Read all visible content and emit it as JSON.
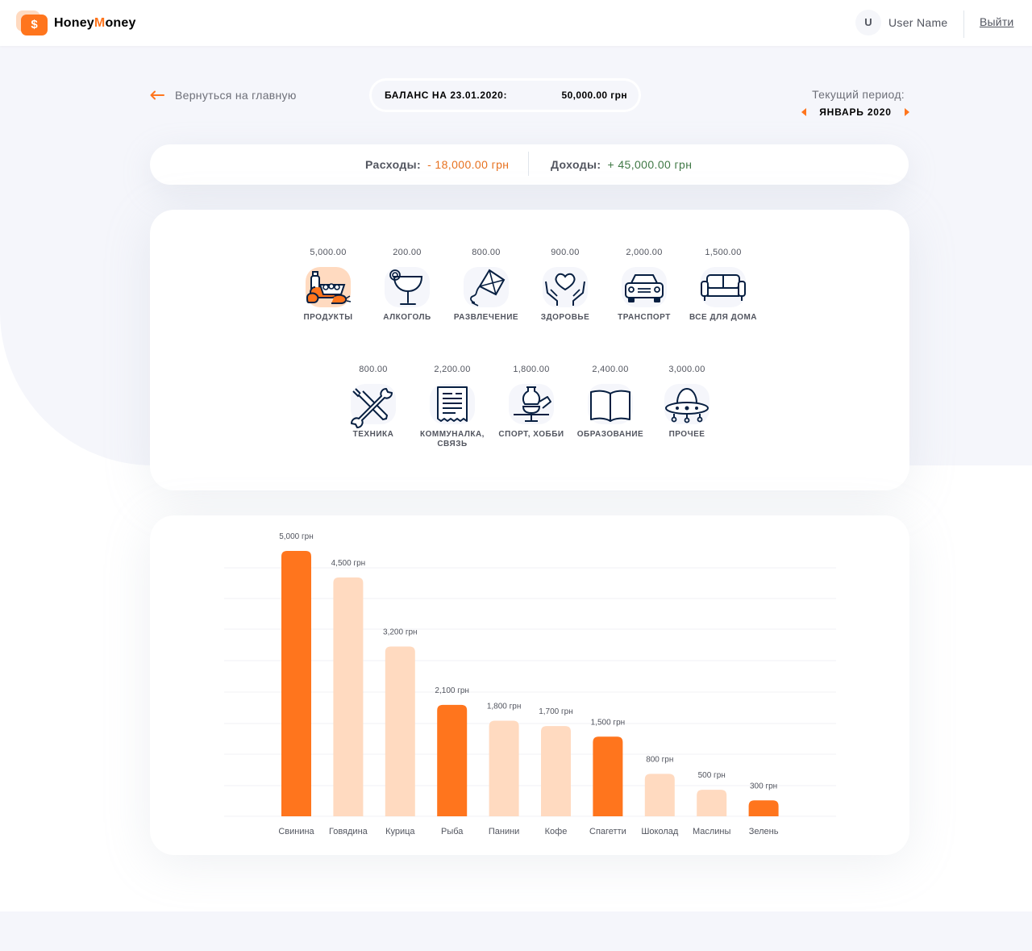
{
  "header": {
    "logo_part1": "Honey",
    "logo_part2": "M",
    "logo_part3": "oney",
    "logo_symbol": "$",
    "avatar_letter": "U",
    "user_name": "User Name",
    "logout_label": "Выйти"
  },
  "nav": {
    "back_label": "Вернуться на главную",
    "balance_label": "БАЛАНС НА 23.01.2020:",
    "balance_value": "50,000.00 грн",
    "period_label": "Текущий период:",
    "period_value": "ЯНВАРЬ 2020"
  },
  "summary": {
    "expenses_label": "Расходы:",
    "expenses_value": "- 18,000.00 грн",
    "income_label": "Доходы:",
    "income_value": "+ 45,000.00 грн"
  },
  "categories": [
    {
      "amount": "5,000.00",
      "label": "ПРОДУКТЫ",
      "icon": "groceries-icon",
      "active": true
    },
    {
      "amount": "200.00",
      "label": "АЛКОГОЛЬ",
      "icon": "cocktail-icon",
      "active": false
    },
    {
      "amount": "800.00",
      "label": "РАЗВЛЕЧЕНИЕ",
      "icon": "kite-icon",
      "active": false
    },
    {
      "amount": "900.00",
      "label": "ЗДОРОВЬЕ",
      "icon": "heart-hands-icon",
      "active": false
    },
    {
      "amount": "2,000.00",
      "label": "ТРАНСПОРТ",
      "icon": "car-icon",
      "active": false
    },
    {
      "amount": "1,500.00",
      "label": "ВСЕ ДЛЯ ДОМА",
      "icon": "sofa-icon",
      "active": false
    },
    {
      "amount": "800.00",
      "label": "ТЕХНИКА",
      "icon": "tools-icon",
      "active": false
    },
    {
      "amount": "2,200.00",
      "label": "КОММУНАЛКА, СВЯЗЬ",
      "icon": "receipt-icon",
      "active": false
    },
    {
      "amount": "1,800.00",
      "label": "СПОРТ, ХОББИ",
      "icon": "pottery-icon",
      "active": false
    },
    {
      "amount": "2,400.00",
      "label": "ОБРАЗОВАНИЕ",
      "icon": "book-icon",
      "active": false
    },
    {
      "amount": "3,000.00",
      "label": "ПРОЧЕЕ",
      "icon": "ufo-icon",
      "active": false
    }
  ],
  "colors": {
    "accent": "#ff751d",
    "accent_light": "#ffdac0",
    "expense": "#e7711f",
    "income": "#407946",
    "icon_stroke": "#071f41"
  },
  "chart_data": {
    "type": "bar",
    "categories": [
      "Свинина",
      "Говядина",
      "Курица",
      "Рыба",
      "Панини",
      "Кофе",
      "Спагетти",
      "Шоколад",
      "Маслины",
      "Зелень"
    ],
    "values": [
      5000,
      4500,
      3200,
      2100,
      1800,
      1700,
      1500,
      800,
      500,
      300
    ],
    "value_labels": [
      "5,000 грн",
      "4,500 грн",
      "3,200 грн",
      "2,100 грн",
      "1,800 грн",
      "1,700 грн",
      "1,500 грн",
      "800 грн",
      "500 грн",
      "300 грн"
    ],
    "bar_colors": [
      "#ff751d",
      "#ffdac0",
      "#ffdac0",
      "#ff751d",
      "#ffdac0",
      "#ffdac0",
      "#ff751d",
      "#ffdac0",
      "#ffdac0",
      "#ff751d"
    ],
    "grid": true,
    "ylim": [
      0,
      5000
    ],
    "title": "",
    "xlabel": "",
    "ylabel": ""
  }
}
